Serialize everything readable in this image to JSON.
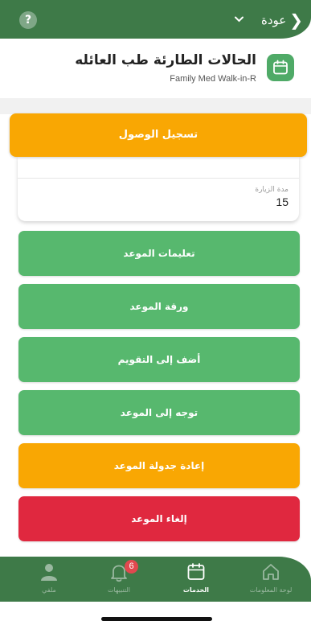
{
  "topbar": {
    "help_label": "?",
    "back_label": "عودة",
    "back_chevron": "❮",
    "dropdown_chevron": "⌄",
    "icons": {
      "help": "help-circle-icon",
      "back": "chevron-left-icon",
      "dropdown": "chevron-down-icon"
    }
  },
  "header": {
    "title": "الحالات الطارئة طب العائله",
    "subtitle": "Family Med Walk-in-R",
    "icon": "calendar-icon"
  },
  "checkin_button": {
    "label": "تسجيل الوصول"
  },
  "info_card": {
    "visit_duration_label": "مدة الزيارة",
    "visit_duration_value": "15"
  },
  "actions": [
    {
      "label": "تعليمات الموعد",
      "color": "#57b86e"
    },
    {
      "label": "ورقة الموعد",
      "color": "#57b86e"
    },
    {
      "label": "أضف إلى التقويم",
      "color": "#57b86e"
    },
    {
      "label": "توجه إلى الموعد",
      "color": "#57b86e"
    },
    {
      "label": "إعادة جدولة الموعد",
      "color": "#f9a703"
    },
    {
      "label": "إلغاء الموعد",
      "color": "#e0283f"
    }
  ],
  "bottom_nav": {
    "items": [
      {
        "label": "ملفي",
        "icon": "profile-icon",
        "active": false
      },
      {
        "label": "التنبيهات",
        "icon": "bell-icon",
        "active": false,
        "badge": "6"
      },
      {
        "label": "الخدمات",
        "icon": "calendar-icon",
        "active": true
      },
      {
        "label": "لوحة المعلومات",
        "icon": "home-icon",
        "active": false
      }
    ]
  },
  "colors": {
    "primary_green": "#3e7a48",
    "accent_green": "#57b86e",
    "orange": "#f9a703",
    "red": "#e0283f"
  }
}
